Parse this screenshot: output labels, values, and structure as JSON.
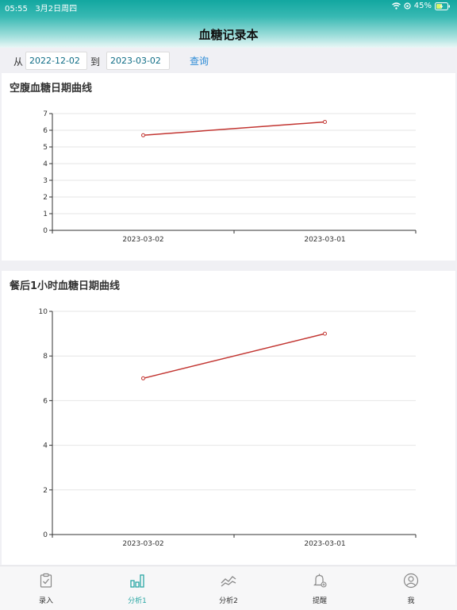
{
  "status_bar": {
    "time": "05:55",
    "date": "3月2日周四",
    "battery": "45%"
  },
  "header": {
    "title": "血糖记录本"
  },
  "filter": {
    "from_label": "从",
    "from_value": "2022-12-02",
    "to_label": "到",
    "to_value": "2023-03-02",
    "query_label": "查询"
  },
  "chart_data": [
    {
      "type": "line",
      "title": "空腹血糖日期曲线",
      "categories": [
        "2023-03-02",
        "2023-03-01"
      ],
      "values": [
        5.7,
        6.5
      ],
      "ylim": [
        0,
        7
      ],
      "yticks": [
        "0",
        "1",
        "2",
        "3",
        "4",
        "5",
        "6",
        "7"
      ],
      "grid": true,
      "color": "#c23531"
    },
    {
      "type": "line",
      "title": "餐后1小时血糖日期曲线",
      "categories": [
        "2023-03-02",
        "2023-03-01"
      ],
      "values": [
        7,
        9
      ],
      "ylim": [
        0,
        10
      ],
      "yticks": [
        "0",
        "2",
        "4",
        "6",
        "8",
        "10"
      ],
      "grid": true,
      "color": "#c23531"
    }
  ],
  "tabbar": {
    "active_color": "#2aa7a4",
    "items": [
      {
        "label": "录入",
        "icon": "clipboard-check-icon"
      },
      {
        "label": "分析1",
        "icon": "bar-chart-icon"
      },
      {
        "label": "分析2",
        "icon": "line-trend-icon"
      },
      {
        "label": "提醒",
        "icon": "bell-icon"
      },
      {
        "label": "我",
        "icon": "user-icon"
      }
    ]
  }
}
